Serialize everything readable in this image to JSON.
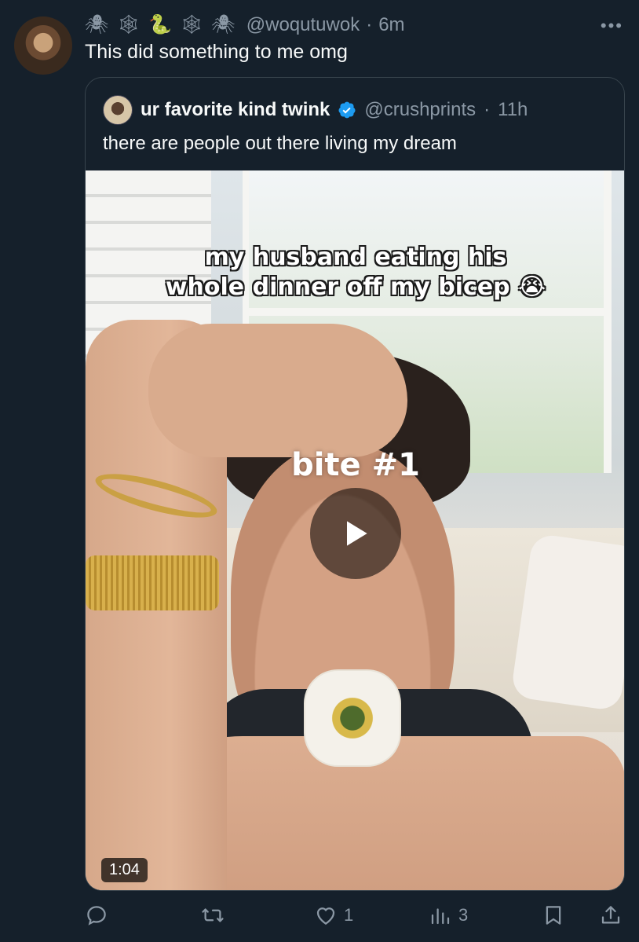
{
  "tweet": {
    "emojis": [
      "🕷",
      "🕸",
      "🐍",
      "🕸",
      "🕷"
    ],
    "handle": "@woqutuwok",
    "separator": "·",
    "time": "6m",
    "text": "This did something to me omg"
  },
  "quoted": {
    "name": "ur favorite kind twink",
    "handle": "@crushprints",
    "separator": "·",
    "time": "11h",
    "text": "there are people out there living my dream",
    "video": {
      "caption_line1": "my husband eating his",
      "caption_line2": "whole dinner off my bicep 😭",
      "overlay_text": "bite #1",
      "duration": "1:04"
    }
  },
  "actions": {
    "reply_icon": "reply-icon",
    "retweet_icon": "retweet-icon",
    "like_count": "1",
    "views_count": "3"
  },
  "colors": {
    "background": "#15202b",
    "secondary_text": "#8b98a5",
    "verified": "#1d9bf0",
    "border": "#38444d"
  }
}
